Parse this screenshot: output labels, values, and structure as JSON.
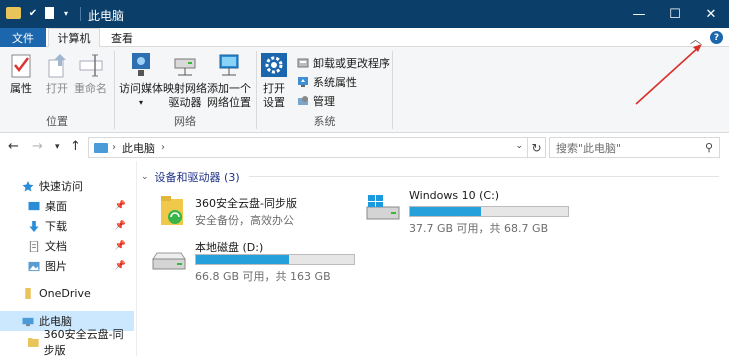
{
  "window": {
    "title": "此电脑",
    "controls": {
      "minimize": "—",
      "maximize": "☐",
      "close": "✕"
    }
  },
  "ribbon_tabs": {
    "file": "文件",
    "computer": "计算机",
    "view": "查看"
  },
  "ribbon": {
    "groups": {
      "location": "位置",
      "network": "网络",
      "system": "系统"
    },
    "buttons": {
      "properties": "属性",
      "open": "打开",
      "rename": "重命名",
      "access_media": "访问媒体",
      "map_drive": [
        "映射网络",
        "驱动器"
      ],
      "add_location": [
        "添加一个",
        "网络位置"
      ],
      "open_settings": [
        "打开",
        "设置"
      ],
      "uninstall": "卸载或更改程序",
      "system_properties": "系统属性",
      "manage": "管理"
    }
  },
  "address_bar": {
    "crumb": "此电脑",
    "search_placeholder": "搜索\"此电脑\""
  },
  "nav_pane": {
    "items": [
      {
        "label": "快速访问",
        "icon": "star-icon",
        "pinned": false
      },
      {
        "label": "桌面",
        "icon": "desktop-folder-icon",
        "pinned": true
      },
      {
        "label": "下载",
        "icon": "download-folder-icon",
        "pinned": true
      },
      {
        "label": "文档",
        "icon": "documents-folder-icon",
        "pinned": true
      },
      {
        "label": "图片",
        "icon": "pictures-folder-icon",
        "pinned": true
      },
      {
        "label": "OneDrive",
        "icon": "onedrive-icon",
        "pinned": false
      },
      {
        "label": "此电脑",
        "icon": "this-pc-icon",
        "pinned": false,
        "selected": true
      },
      {
        "label": "360安全云盘-同步版",
        "icon": "cloud-folder-icon",
        "pinned": false
      }
    ]
  },
  "content": {
    "section_title": "设备和驱动器 (3)",
    "items": [
      {
        "name": "360安全云盘-同步版",
        "subtitle": "安全备份，高效办公",
        "type": "app"
      },
      {
        "name": "Windows 10 (C:)",
        "usage": "37.7 GB 可用，共 68.7 GB",
        "used_fraction": 0.45,
        "type": "drive"
      },
      {
        "name": "本地磁盘 (D:)",
        "usage": "66.8 GB 可用，共 163 GB",
        "used_fraction": 0.59,
        "type": "drive"
      }
    ]
  },
  "colors": {
    "titlebar": "#0b3f69",
    "file_tab": "#1c66ad",
    "drive_bar": "#26a0da",
    "annotation_arrow": "#d9302a"
  }
}
